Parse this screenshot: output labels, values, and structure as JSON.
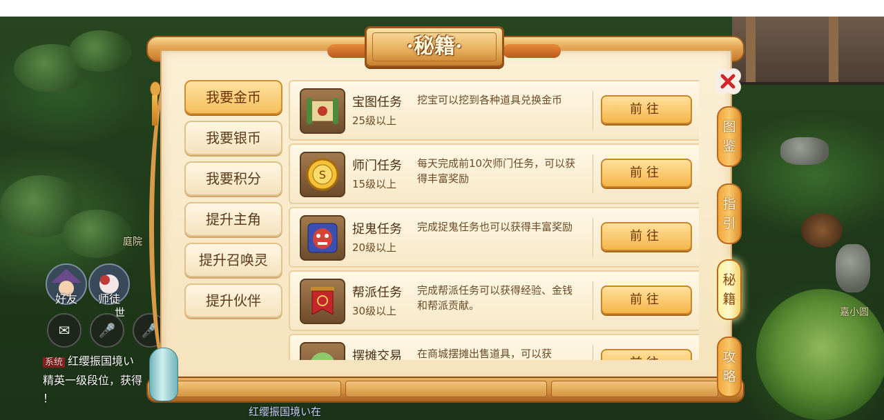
{
  "panel": {
    "title": "·秘籍·",
    "categories": [
      {
        "label": "我要金币",
        "active": true
      },
      {
        "label": "我要银币",
        "active": false
      },
      {
        "label": "我要积分",
        "active": false
      },
      {
        "label": "提升主角",
        "active": false
      },
      {
        "label": "提升召唤灵",
        "active": false
      },
      {
        "label": "提升伙伴",
        "active": false
      }
    ],
    "rows": [
      {
        "icon": "treasure-map-icon",
        "name": "宝图任务",
        "level": "25级以上",
        "desc": "挖宝可以挖到各种道具兑换金币",
        "button": "前往"
      },
      {
        "icon": "sect-coin-icon",
        "name": "师门任务",
        "level": "15级以上",
        "desc": "每天完成前10次师门任务，可以获得丰富奖励",
        "button": "前往"
      },
      {
        "icon": "ghost-mask-icon",
        "name": "捉鬼任务",
        "level": "20级以上",
        "desc": "完成捉鬼任务也可以获得丰富奖励",
        "button": "前往"
      },
      {
        "icon": "guild-banner-icon",
        "name": "帮派任务",
        "level": "30级以上",
        "desc": "完成帮派任务可以获得经验、金钱和帮派贡献。",
        "button": "前往"
      },
      {
        "icon": "stall-icon",
        "name": "摆摊交易",
        "level": "",
        "desc": "在商城摆摊出售道具，可以获",
        "button": "前往"
      }
    ],
    "side_tabs": [
      {
        "label": "图鉴",
        "active": false
      },
      {
        "label": "指引",
        "active": false
      },
      {
        "label": "秘籍",
        "active": true
      },
      {
        "label": "攻略",
        "active": false
      }
    ]
  },
  "hud": {
    "friends_label": "好友",
    "mentor_label": "师徒",
    "voice_badge": "世",
    "chat_tag": "系统",
    "chat_line1": "红缨振国境い",
    "chat_line2": "精英一级段位，获得",
    "chat_line3": "！",
    "bottom_ticker": "红缨振国境い在",
    "npc_left": "庭院",
    "npc_right": "嘉小圆"
  },
  "colors": {
    "accent_gold": "#f5b54a",
    "paper": "#fbf0d6",
    "text_brown": "#4a2f14",
    "close_red": "#d0262a"
  }
}
